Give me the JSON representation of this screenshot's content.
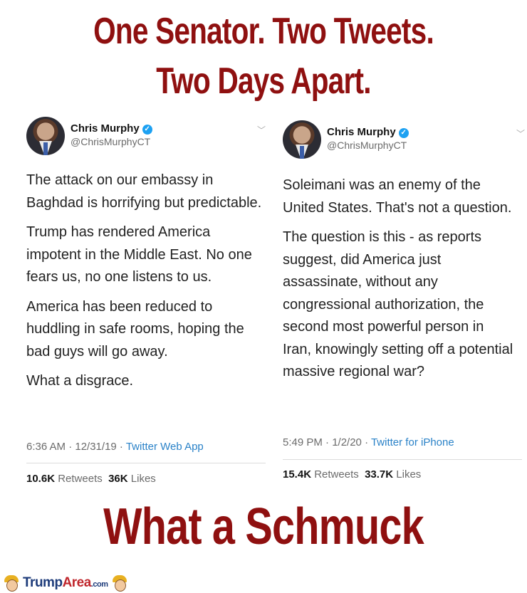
{
  "headline": {
    "line1": "One Senator. Two Tweets.",
    "line2": "Two Days Apart."
  },
  "tweets": [
    {
      "name": "Chris Murphy",
      "handle": "@ChrisMurphyCT",
      "paragraphs": [
        "The attack on our embassy in Baghdad is horrifying but predictable.",
        "Trump has rendered America impotent in the Middle East. No one fears us, no one listens to us.",
        "America has been reduced to huddling in safe rooms, hoping the bad guys will go away.",
        "What a disgrace."
      ],
      "time": "6:36 AM · 12/31/19 · ",
      "app": "Twitter Web App",
      "retweets": "10.6K",
      "retweets_label": "Retweets",
      "likes": "36K",
      "likes_label": "Likes"
    },
    {
      "name": "Chris Murphy",
      "handle": "@ChrisMurphyCT",
      "paragraphs": [
        "Soleimani was an enemy of the United States. That's not a question.",
        "The question is this - as reports suggest, did America just assassinate, without any congressional authorization, the second most powerful person in Iran, knowingly setting off a potential massive regional war?"
      ],
      "time": "5:49 PM · 1/2/20 · ",
      "app": "Twitter for iPhone",
      "retweets": "15.4K",
      "retweets_label": "Retweets",
      "likes": "33.7K",
      "likes_label": "Likes"
    }
  ],
  "caption": "What a Schmuck",
  "brand": {
    "part1": "Trump",
    "part2": "Area",
    "part3": ".com"
  },
  "colors": {
    "headline": "#8f1010",
    "link": "#2a82c8",
    "verified": "#1da1f2"
  },
  "icons": [
    "verified-badge-icon",
    "chevron-down-icon",
    "mascot-icon"
  ]
}
